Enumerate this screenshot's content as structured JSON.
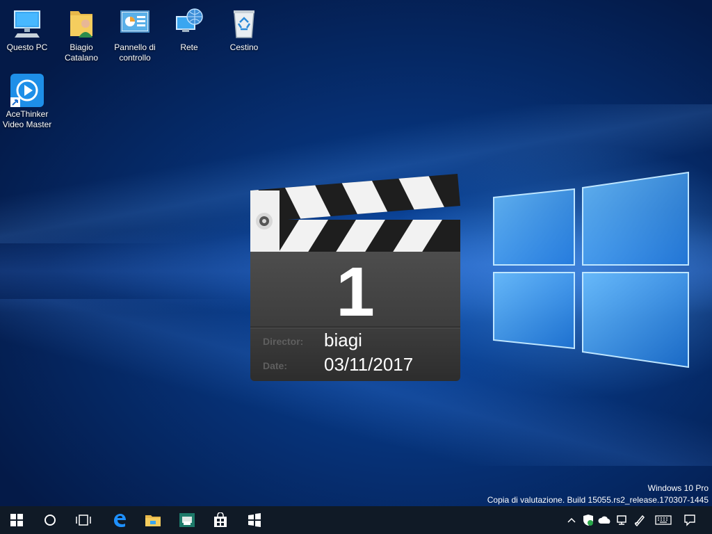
{
  "desktop": {
    "icons": [
      {
        "label_line1": "Questo PC",
        "label_line2": "",
        "icon": "computer-icon"
      },
      {
        "label_line1": "Biagio",
        "label_line2": "Catalano",
        "icon": "user-folder-icon"
      },
      {
        "label_line1": "Pannello di",
        "label_line2": "controllo",
        "icon": "control-panel-icon"
      },
      {
        "label_line1": "Rete",
        "label_line2": "",
        "icon": "network-icon"
      },
      {
        "label_line1": "Cestino",
        "label_line2": "",
        "icon": "recycle-bin-icon"
      },
      {
        "label_line1": "AceThinker",
        "label_line2": "Video Master",
        "icon": "acethinker-icon"
      }
    ]
  },
  "clapperboard": {
    "number": "1",
    "director_label": "Director:",
    "director_value": "biagi",
    "date_label": "Date:",
    "date_value": "03/11/2017"
  },
  "watermark": {
    "line1": "Windows 10 Pro",
    "line2": "Copia di valutazione. Build 15055.rs2_release.170307-1445"
  },
  "taskbar": {
    "buttons": [
      "start-icon",
      "cortana-icon",
      "task-view-icon",
      "edge-icon",
      "file-explorer-icon",
      "app-icon",
      "store-icon",
      "snip-icon"
    ],
    "tray": [
      "chevron-up-icon",
      "defender-icon",
      "onedrive-icon",
      "network-icon",
      "pen-icon",
      "keyboard-icon",
      "notifications-icon"
    ]
  },
  "colors": {
    "taskbar_bg": "#101a26",
    "accent": "#1e90ff"
  }
}
